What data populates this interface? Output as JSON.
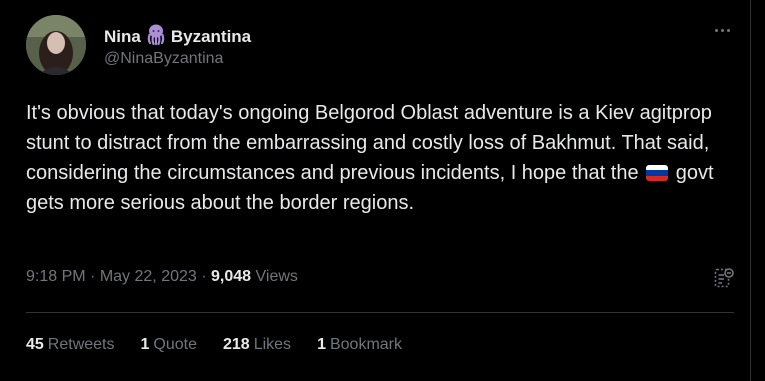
{
  "author": {
    "name_first": "Nina",
    "name_last": "Byzantina",
    "handle": "@NinaByzantina",
    "emoji": "octopus"
  },
  "tweet": {
    "text_before_flag": "It's obvious that today's ongoing Belgorod Oblast adventure is a Kiev agitprop stunt to distract from the embarrassing and costly loss of Bakhmut. That said, considering the circumstances and previous incidents, I hope that the",
    "flag": "russia-flag",
    "text_after_flag": "govt gets more serious about the border regions."
  },
  "meta": {
    "time": "9:18 PM",
    "sep1": "·",
    "date": "May 22, 2023",
    "sep2": "·",
    "views_count": "9,048",
    "views_label": "Views"
  },
  "stats": {
    "retweets_count": "45",
    "retweets_label": "Retweets",
    "quotes_count": "1",
    "quotes_label": "Quote",
    "likes_count": "218",
    "likes_label": "Likes",
    "bookmarks_count": "1",
    "bookmarks_label": "Bookmark"
  },
  "colors": {
    "background": "#000000",
    "text": "#e7e9ea",
    "muted": "#71767b",
    "divider": "#2f3336",
    "octopus": "#aa8ed6"
  }
}
